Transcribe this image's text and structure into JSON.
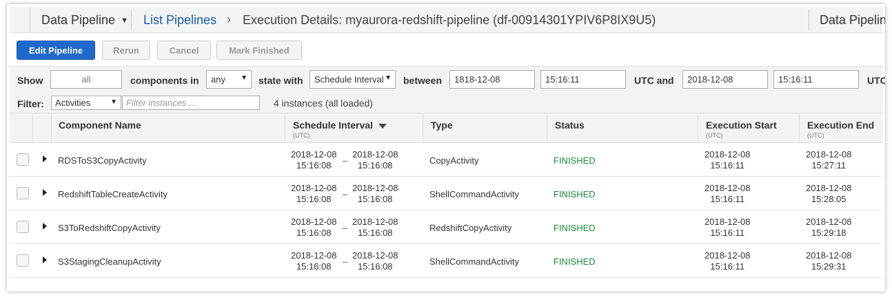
{
  "header": {
    "service_label": "Data Pipeline",
    "breadcrumb_link": "List Pipelines",
    "breadcrumb_sep": "›",
    "breadcrumb_current": "Execution Details: myaurora-redshift-pipeline (df-00914301YPIV6P8IX9U5)",
    "service_label_right": "Data Pipeline"
  },
  "toolbar": {
    "edit": "Edit Pipeline",
    "rerun": "Rerun",
    "cancel": "Cancel",
    "mark_finished": "Mark Finished"
  },
  "filters": {
    "show_label": "Show",
    "show_value": "all",
    "components_in_label": "components in",
    "components_in_value": "any",
    "state_with_label": "state with",
    "state_with_value": "Schedule Interval",
    "between_label": "between",
    "start_date": "1818-12-08",
    "start_time": "15:16:11",
    "utc_and_label": "UTC and",
    "end_date": "2018-12-08",
    "end_time": "15:16:11",
    "utc_label": "UTC",
    "filter_label": "Filter:",
    "filter_type": "Activities",
    "filter_placeholder": "Filter instances ...",
    "instances_info": "4 instances (all loaded)"
  },
  "table": {
    "columns": {
      "component": "Component Name",
      "schedule": "Schedule Interval",
      "schedule_sub": "(UTC)",
      "type": "Type",
      "status": "Status",
      "exec_start": "Execution Start",
      "exec_start_sub": "(UTC)",
      "exec_end": "Execution End",
      "exec_end_sub": "(UTC)"
    },
    "rows": [
      {
        "name": "RDSToS3CopyActivity",
        "sched_from_date": "2018-12-08",
        "sched_from_time": "15:16:08",
        "sched_to_date": "2018-12-08",
        "sched_to_time": "15:16:08",
        "type": "CopyActivity",
        "status": "FINISHED",
        "start_date": "2018-12-08",
        "start_time": "15:16:11",
        "end_date": "2018-12-08",
        "end_time": "15:27:11"
      },
      {
        "name": "RedshiftTableCreateActivity",
        "sched_from_date": "2018-12-08",
        "sched_from_time": "15:16:08",
        "sched_to_date": "2018-12-08",
        "sched_to_time": "15:16:08",
        "type": "ShellCommandActivity",
        "status": "FINISHED",
        "start_date": "2018-12-08",
        "start_time": "15:16:11",
        "end_date": "2018-12-08",
        "end_time": "15:28:05"
      },
      {
        "name": "S3ToRedshiftCopyActivity",
        "sched_from_date": "2018-12-08",
        "sched_from_time": "15:16:08",
        "sched_to_date": "2018-12-08",
        "sched_to_time": "15:16:08",
        "type": "RedshiftCopyActivity",
        "status": "FINISHED",
        "start_date": "2018-12-08",
        "start_time": "15:16:11",
        "end_date": "2018-12-08",
        "end_time": "15:29:18"
      },
      {
        "name": "S3StagingCleanupActivity",
        "sched_from_date": "2018-12-08",
        "sched_from_time": "15:16:08",
        "sched_to_date": "2018-12-08",
        "sched_to_time": "15:16:08",
        "type": "ShellCommandActivity",
        "status": "FINISHED",
        "start_date": "2018-12-08",
        "start_time": "15:16:11",
        "end_date": "2018-12-08",
        "end_time": "15:29:31"
      }
    ]
  },
  "colors": {
    "primary_button": "#1f69cc",
    "link": "#1a5da8",
    "status_finished": "#1d8a3a"
  }
}
